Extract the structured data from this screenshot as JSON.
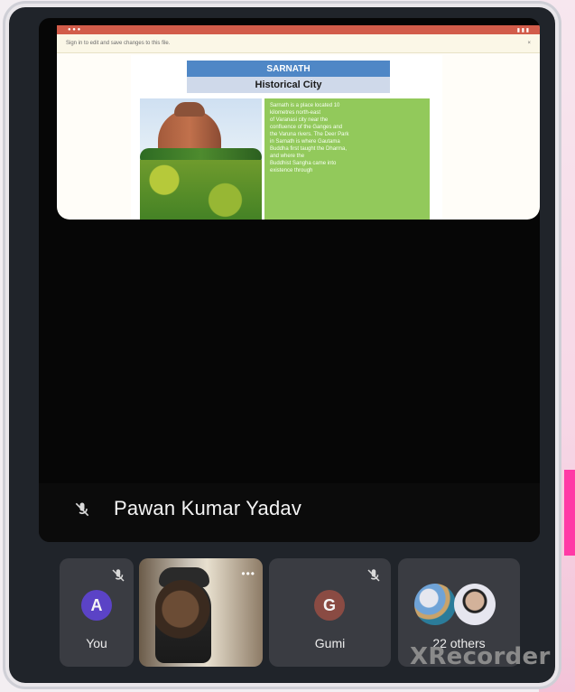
{
  "shared_screen": {
    "signin_bar_text": "Sign in to edit and save changes to this file.",
    "document": {
      "title": "SARNATH",
      "subtitle": "Historical City",
      "text_lines": [
        "Sarnath is a place located 10",
        "kilometres north-east",
        "of Varanasi city near the",
        "confluence of the Ganges and",
        "the Varuna rivers. The Deer Park",
        "in Sarnath is where Gautama",
        "Buddha first taught the Dharma,",
        "and where the",
        "Buddhist Sangha came into",
        "existence through"
      ]
    }
  },
  "presenter": {
    "name": "Pawan Kumar Yadav"
  },
  "participants": {
    "you": {
      "avatar_letter": "A",
      "label": "You",
      "avatar_color": "#5b43c6"
    },
    "gumi": {
      "avatar_letter": "G",
      "label": "Gumi",
      "avatar_color": "#8a4b43"
    },
    "others": {
      "label": "22 others"
    }
  },
  "watermark": {
    "text": "XRecorder"
  }
}
